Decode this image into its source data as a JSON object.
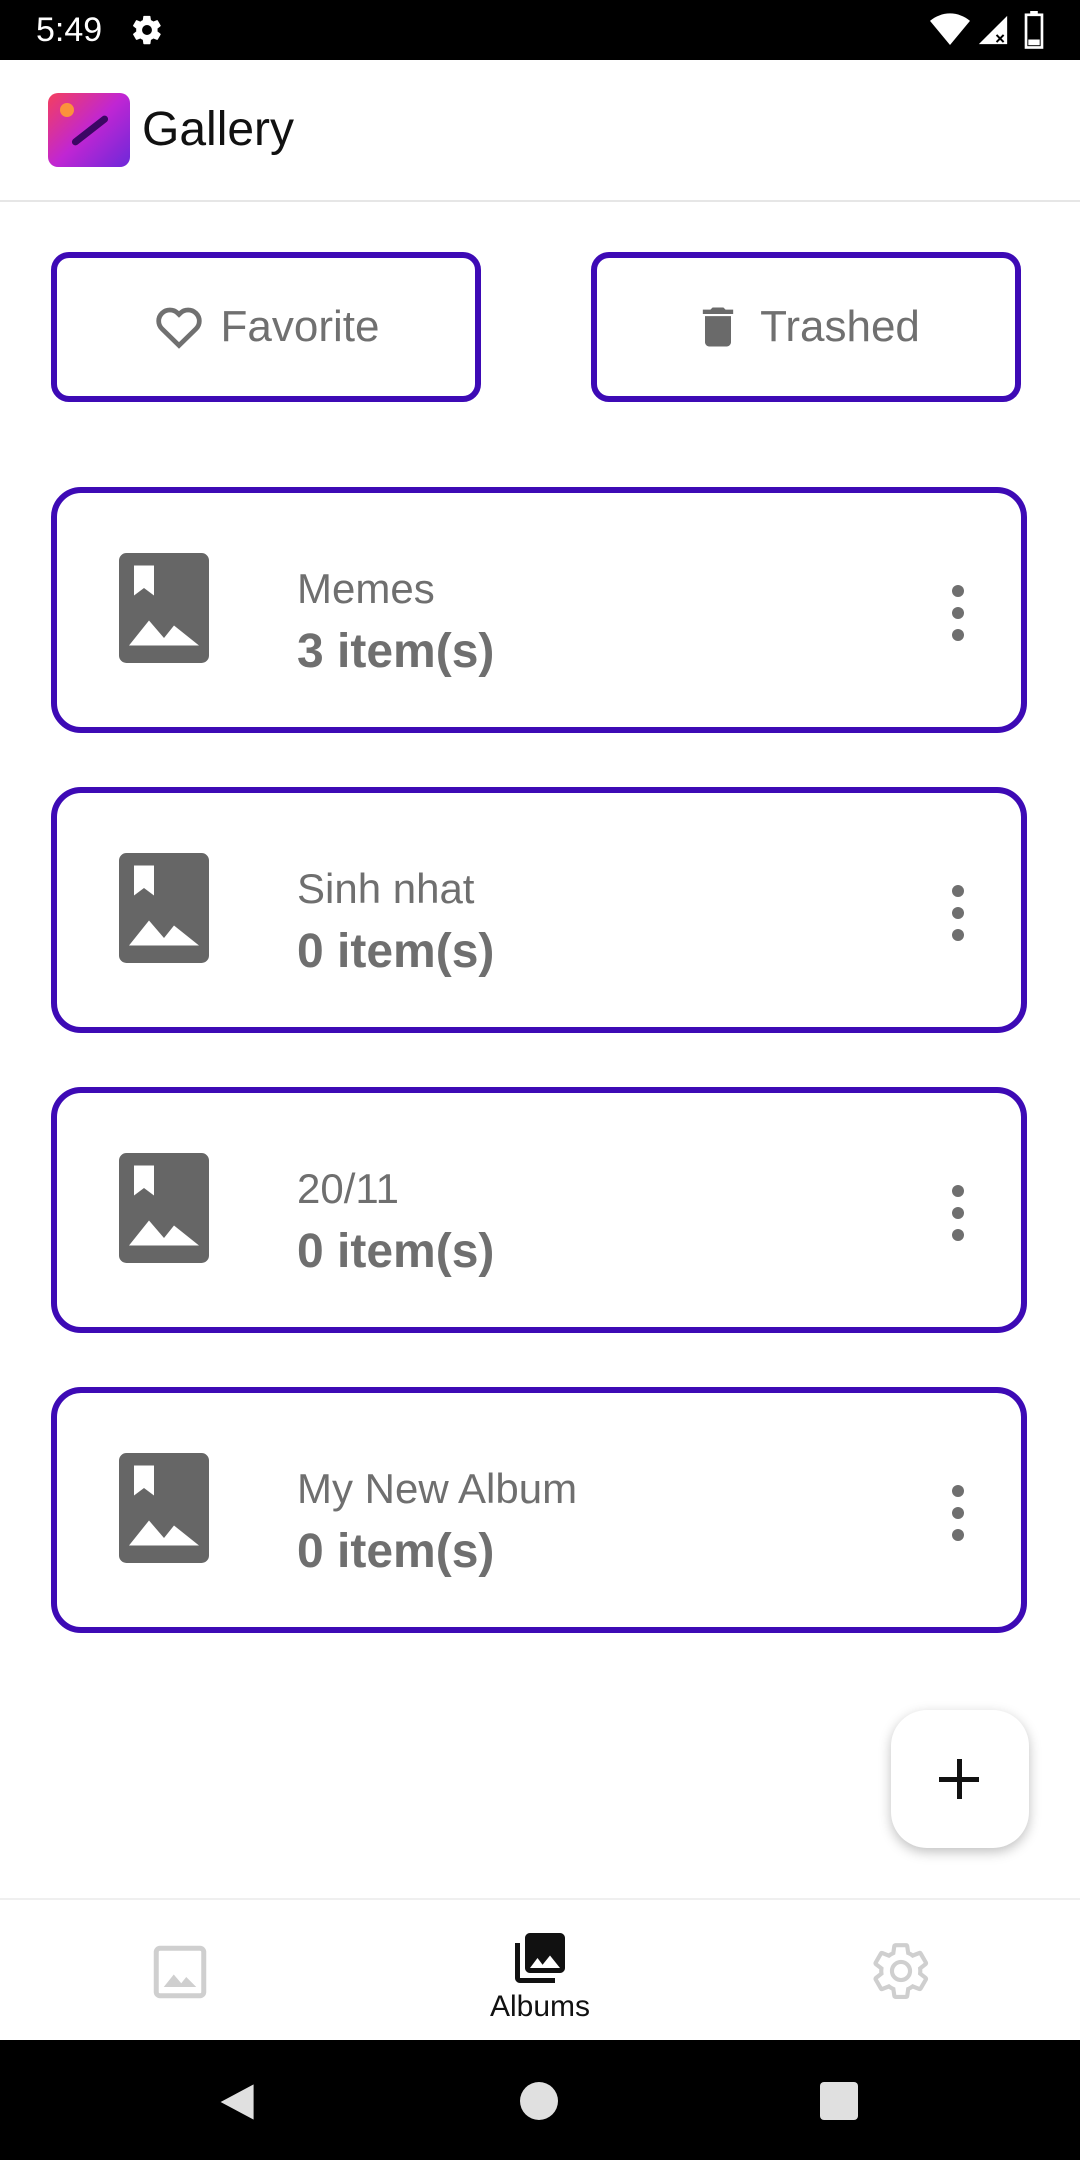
{
  "status_bar": {
    "time": "5:49"
  },
  "app_bar": {
    "title": "Gallery"
  },
  "quick_actions": {
    "favorite_label": "Favorite",
    "trashed_label": "Trashed"
  },
  "albums": [
    {
      "name": "Memes",
      "count": "3 item(s)"
    },
    {
      "name": "Sinh nhat",
      "count": "0 item(s)"
    },
    {
      "name": "20/11",
      "count": "0 item(s)"
    },
    {
      "name": "My New Album",
      "count": "0 item(s)"
    }
  ],
  "bottom_nav": {
    "items": [
      {
        "icon": "photo-icon",
        "label": ""
      },
      {
        "icon": "albums-icon",
        "label": "Albums"
      },
      {
        "icon": "settings-icon",
        "label": ""
      }
    ],
    "selected": "Albums"
  },
  "colors": {
    "accent": "#3d0ab5",
    "text_muted": "#6f6f6f",
    "status_bar": "#000000"
  }
}
